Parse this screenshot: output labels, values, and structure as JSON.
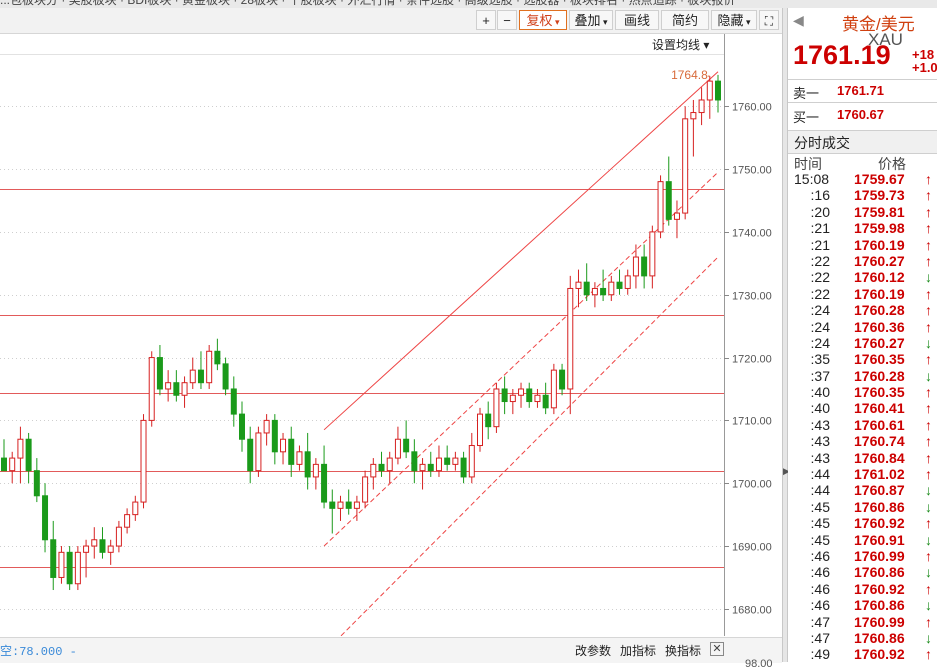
{
  "top_menu": [
    "...包板块分 · 美股板块 · BDI板块 · 黄金板块 · 28板块 · 个股板块 · 外汇行情 · 条件选股 · 高级选股 · 选股器 · 板块排名 · 热点追踪 · 板块报价"
  ],
  "toolbar": {
    "zoom_in": "+",
    "zoom_out": "−",
    "fuquan": "复权",
    "diejia": "叠加",
    "huaxian": "画线",
    "jianyue": "简约",
    "yincang": "隐藏",
    "expand": "⛶"
  },
  "chart_controls": {
    "ma_setting": "设置均线 ▾"
  },
  "bottom_bar": {
    "axis_readout": "空:78.000 -",
    "change_params": "改参数",
    "add_indicator": "加指标",
    "switch_indicator": "换指标",
    "close": "✕",
    "under_tick": "98.00"
  },
  "right_panel": {
    "title": "黄金/美元",
    "code": "XAU",
    "price": "1761.19",
    "change_abs": "+18",
    "change_pct": "+1.0",
    "sell1_label": "卖一",
    "sell1_value": "1761.71",
    "buy1_label": "买一",
    "buy1_value": "1760.67",
    "ticks_title": "分时成交",
    "col_time": "时间",
    "col_price": "价格",
    "ticks": [
      {
        "t": "15:08",
        "p": "1759.67",
        "d": "up"
      },
      {
        "t": ":16",
        "p": "1759.73",
        "d": "up"
      },
      {
        "t": ":20",
        "p": "1759.81",
        "d": "up"
      },
      {
        "t": ":21",
        "p": "1759.98",
        "d": "up"
      },
      {
        "t": ":21",
        "p": "1760.19",
        "d": "up"
      },
      {
        "t": ":22",
        "p": "1760.27",
        "d": "up"
      },
      {
        "t": ":22",
        "p": "1760.12",
        "d": "dn"
      },
      {
        "t": ":22",
        "p": "1760.19",
        "d": "up"
      },
      {
        "t": ":24",
        "p": "1760.28",
        "d": "up"
      },
      {
        "t": ":24",
        "p": "1760.36",
        "d": "up"
      },
      {
        "t": ":24",
        "p": "1760.27",
        "d": "dn"
      },
      {
        "t": ":35",
        "p": "1760.35",
        "d": "up"
      },
      {
        "t": ":37",
        "p": "1760.28",
        "d": "dn"
      },
      {
        "t": ":40",
        "p": "1760.35",
        "d": "up"
      },
      {
        "t": ":40",
        "p": "1760.41",
        "d": "up"
      },
      {
        "t": ":43",
        "p": "1760.61",
        "d": "up"
      },
      {
        "t": ":43",
        "p": "1760.74",
        "d": "up"
      },
      {
        "t": ":43",
        "p": "1760.84",
        "d": "up"
      },
      {
        "t": ":44",
        "p": "1761.02",
        "d": "up"
      },
      {
        "t": ":44",
        "p": "1760.87",
        "d": "dn"
      },
      {
        "t": ":45",
        "p": "1760.86",
        "d": "dn"
      },
      {
        "t": ":45",
        "p": "1760.92",
        "d": "up"
      },
      {
        "t": ":45",
        "p": "1760.91",
        "d": "dn"
      },
      {
        "t": ":46",
        "p": "1760.99",
        "d": "up"
      },
      {
        "t": ":46",
        "p": "1760.86",
        "d": "dn"
      },
      {
        "t": ":46",
        "p": "1760.92",
        "d": "up"
      },
      {
        "t": ":46",
        "p": "1760.86",
        "d": "dn"
      },
      {
        "t": ":47",
        "p": "1760.99",
        "d": "up"
      },
      {
        "t": ":47",
        "p": "1760.86",
        "d": "dn"
      },
      {
        "t": ":49",
        "p": "1760.92",
        "d": "up"
      }
    ],
    "arrow_up": "↑",
    "arrow_down": "↓"
  },
  "chart_data": {
    "type": "candlestick",
    "title": "",
    "ylim": [
      1676,
      1768
    ],
    "yticks": [
      1680,
      1690,
      1700,
      1710,
      1720,
      1730,
      1740,
      1750,
      1760
    ],
    "ytick_labels": [
      "1680.00",
      "1690.00",
      "1700.00",
      "1710.00",
      "1720.00",
      "1730.00",
      "1740.00",
      "1750.00",
      "1760.00"
    ],
    "high_label": "1764.8",
    "horizontal_levels": [
      1746.8,
      1726.8,
      1714.3,
      1702.0,
      1686.7
    ],
    "up_color": "#d62020",
    "down_color": "#1a9a1a",
    "candles": [
      {
        "o": 1704,
        "h": 1707,
        "l": 1702,
        "c": 1702
      },
      {
        "o": 1702,
        "h": 1705,
        "l": 1700,
        "c": 1704
      },
      {
        "o": 1704,
        "h": 1709,
        "l": 1700,
        "c": 1707
      },
      {
        "o": 1707,
        "h": 1708,
        "l": 1700,
        "c": 1702
      },
      {
        "o": 1702,
        "h": 1704,
        "l": 1697,
        "c": 1698
      },
      {
        "o": 1698,
        "h": 1700,
        "l": 1689,
        "c": 1691
      },
      {
        "o": 1691,
        "h": 1694,
        "l": 1683,
        "c": 1685
      },
      {
        "o": 1685,
        "h": 1690,
        "l": 1684,
        "c": 1689
      },
      {
        "o": 1689,
        "h": 1690,
        "l": 1683,
        "c": 1684
      },
      {
        "o": 1684,
        "h": 1690,
        "l": 1683,
        "c": 1689
      },
      {
        "o": 1689,
        "h": 1691,
        "l": 1685,
        "c": 1690
      },
      {
        "o": 1690,
        "h": 1693,
        "l": 1688,
        "c": 1691
      },
      {
        "o": 1691,
        "h": 1693,
        "l": 1688,
        "c": 1689
      },
      {
        "o": 1689,
        "h": 1691,
        "l": 1687,
        "c": 1690
      },
      {
        "o": 1690,
        "h": 1694,
        "l": 1689,
        "c": 1693
      },
      {
        "o": 1693,
        "h": 1696,
        "l": 1692,
        "c": 1695
      },
      {
        "o": 1695,
        "h": 1698,
        "l": 1694,
        "c": 1697
      },
      {
        "o": 1697,
        "h": 1711,
        "l": 1696,
        "c": 1710
      },
      {
        "o": 1710,
        "h": 1721,
        "l": 1709,
        "c": 1720
      },
      {
        "o": 1720,
        "h": 1722,
        "l": 1714,
        "c": 1715
      },
      {
        "o": 1715,
        "h": 1718,
        "l": 1713,
        "c": 1716
      },
      {
        "o": 1716,
        "h": 1718,
        "l": 1713,
        "c": 1714
      },
      {
        "o": 1714,
        "h": 1717,
        "l": 1712,
        "c": 1716
      },
      {
        "o": 1716,
        "h": 1720,
        "l": 1715,
        "c": 1718
      },
      {
        "o": 1718,
        "h": 1721,
        "l": 1715,
        "c": 1716
      },
      {
        "o": 1716,
        "h": 1722,
        "l": 1715,
        "c": 1721
      },
      {
        "o": 1721,
        "h": 1723,
        "l": 1718,
        "c": 1719
      },
      {
        "o": 1719,
        "h": 1720,
        "l": 1714,
        "c": 1715
      },
      {
        "o": 1715,
        "h": 1717,
        "l": 1709,
        "c": 1711
      },
      {
        "o": 1711,
        "h": 1713,
        "l": 1705,
        "c": 1707
      },
      {
        "o": 1707,
        "h": 1709,
        "l": 1700,
        "c": 1702
      },
      {
        "o": 1702,
        "h": 1709,
        "l": 1701,
        "c": 1708
      },
      {
        "o": 1708,
        "h": 1711,
        "l": 1706,
        "c": 1710
      },
      {
        "o": 1710,
        "h": 1711,
        "l": 1703,
        "c": 1705
      },
      {
        "o": 1705,
        "h": 1708,
        "l": 1703,
        "c": 1707
      },
      {
        "o": 1707,
        "h": 1709,
        "l": 1701,
        "c": 1703
      },
      {
        "o": 1703,
        "h": 1706,
        "l": 1702,
        "c": 1705
      },
      {
        "o": 1705,
        "h": 1708,
        "l": 1699,
        "c": 1701
      },
      {
        "o": 1701,
        "h": 1704,
        "l": 1699,
        "c": 1703
      },
      {
        "o": 1703,
        "h": 1706,
        "l": 1696,
        "c": 1697
      },
      {
        "o": 1697,
        "h": 1699,
        "l": 1692,
        "c": 1696
      },
      {
        "o": 1696,
        "h": 1698,
        "l": 1694,
        "c": 1697
      },
      {
        "o": 1697,
        "h": 1699,
        "l": 1695,
        "c": 1696
      },
      {
        "o": 1696,
        "h": 1698,
        "l": 1694,
        "c": 1697
      },
      {
        "o": 1697,
        "h": 1702,
        "l": 1696,
        "c": 1701
      },
      {
        "o": 1701,
        "h": 1704,
        "l": 1699,
        "c": 1703
      },
      {
        "o": 1703,
        "h": 1705,
        "l": 1701,
        "c": 1702
      },
      {
        "o": 1702,
        "h": 1705,
        "l": 1700,
        "c": 1704
      },
      {
        "o": 1704,
        "h": 1709,
        "l": 1703,
        "c": 1707
      },
      {
        "o": 1707,
        "h": 1710,
        "l": 1704,
        "c": 1705
      },
      {
        "o": 1705,
        "h": 1707,
        "l": 1700,
        "c": 1702
      },
      {
        "o": 1702,
        "h": 1704,
        "l": 1699,
        "c": 1703
      },
      {
        "o": 1703,
        "h": 1705,
        "l": 1701,
        "c": 1702
      },
      {
        "o": 1702,
        "h": 1706,
        "l": 1701,
        "c": 1704
      },
      {
        "o": 1704,
        "h": 1706,
        "l": 1702,
        "c": 1703
      },
      {
        "o": 1703,
        "h": 1705,
        "l": 1702,
        "c": 1704
      },
      {
        "o": 1704,
        "h": 1705,
        "l": 1700,
        "c": 1701
      },
      {
        "o": 1701,
        "h": 1708,
        "l": 1700,
        "c": 1706
      },
      {
        "o": 1706,
        "h": 1712,
        "l": 1705,
        "c": 1711
      },
      {
        "o": 1711,
        "h": 1713,
        "l": 1707,
        "c": 1709
      },
      {
        "o": 1709,
        "h": 1716,
        "l": 1708,
        "c": 1715
      },
      {
        "o": 1715,
        "h": 1717,
        "l": 1711,
        "c": 1713
      },
      {
        "o": 1713,
        "h": 1715,
        "l": 1711,
        "c": 1714
      },
      {
        "o": 1714,
        "h": 1716,
        "l": 1712,
        "c": 1715
      },
      {
        "o": 1715,
        "h": 1716,
        "l": 1712,
        "c": 1713
      },
      {
        "o": 1713,
        "h": 1715,
        "l": 1712,
        "c": 1714
      },
      {
        "o": 1714,
        "h": 1716,
        "l": 1711,
        "c": 1712
      },
      {
        "o": 1712,
        "h": 1719,
        "l": 1711,
        "c": 1718
      },
      {
        "o": 1718,
        "h": 1719,
        "l": 1714,
        "c": 1715
      },
      {
        "o": 1715,
        "h": 1733,
        "l": 1711,
        "c": 1731
      },
      {
        "o": 1731,
        "h": 1734,
        "l": 1728,
        "c": 1732
      },
      {
        "o": 1732,
        "h": 1735,
        "l": 1729,
        "c": 1730
      },
      {
        "o": 1730,
        "h": 1732,
        "l": 1728,
        "c": 1731
      },
      {
        "o": 1731,
        "h": 1734,
        "l": 1729,
        "c": 1730
      },
      {
        "o": 1730,
        "h": 1733,
        "l": 1729,
        "c": 1732
      },
      {
        "o": 1732,
        "h": 1734,
        "l": 1730,
        "c": 1731
      },
      {
        "o": 1731,
        "h": 1734,
        "l": 1730,
        "c": 1733
      },
      {
        "o": 1733,
        "h": 1738,
        "l": 1731,
        "c": 1736
      },
      {
        "o": 1736,
        "h": 1738,
        "l": 1731,
        "c": 1733
      },
      {
        "o": 1733,
        "h": 1741,
        "l": 1731,
        "c": 1740
      },
      {
        "o": 1740,
        "h": 1749,
        "l": 1739,
        "c": 1748
      },
      {
        "o": 1748,
        "h": 1752,
        "l": 1741,
        "c": 1742
      },
      {
        "o": 1742,
        "h": 1745,
        "l": 1739,
        "c": 1743
      },
      {
        "o": 1743,
        "h": 1760,
        "l": 1742,
        "c": 1758
      },
      {
        "o": 1758,
        "h": 1761,
        "l": 1752,
        "c": 1759
      },
      {
        "o": 1759,
        "h": 1763,
        "l": 1757,
        "c": 1761
      },
      {
        "o": 1761,
        "h": 1764.8,
        "l": 1758,
        "c": 1764
      },
      {
        "o": 1764,
        "h": 1765,
        "l": 1759,
        "c": 1761
      }
    ]
  }
}
